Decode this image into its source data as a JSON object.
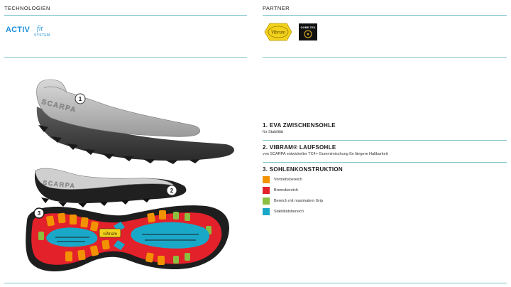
{
  "header": {
    "technologies_title": "TECHNOLOGIEN",
    "partner_title": "PARTNER"
  },
  "technologies": {
    "activfit_main": "ACTIV",
    "activfit_script": "fit",
    "activfit_sub": "SYSTEM"
  },
  "partners": {
    "vibram_label": "Vibram",
    "goretex_label": "GORE-TEX"
  },
  "illustration": {
    "callout_1": "1",
    "callout_2": "2",
    "callout_3": "3",
    "brand_on_midsole": "SCARPA",
    "brand_on_outsole": "SCARPA",
    "vibram_badge": "vibram"
  },
  "features": {
    "eva_title": "1. EVA ZWISCHENSOHLE",
    "eva_sub": "für Stabilität",
    "vibram_title": "2. VIBRAM® LAUFSOHLE",
    "vibram_sub": "von SCARPA entwickelter TC4+ Gummimischung für längere Haltbarkeit",
    "construction_title": "3. SOHLENKONSTRUKTION"
  },
  "key": [
    {
      "label": "Vortriebsbereich",
      "color": "#f39200"
    },
    {
      "label": "Bremsbereich",
      "color": "#e3212b"
    },
    {
      "label": "Bereich mit maximalem Grip",
      "color": "#8bbf3f"
    },
    {
      "label": "Stabilitätsbereich",
      "color": "#1aa8c9"
    }
  ]
}
